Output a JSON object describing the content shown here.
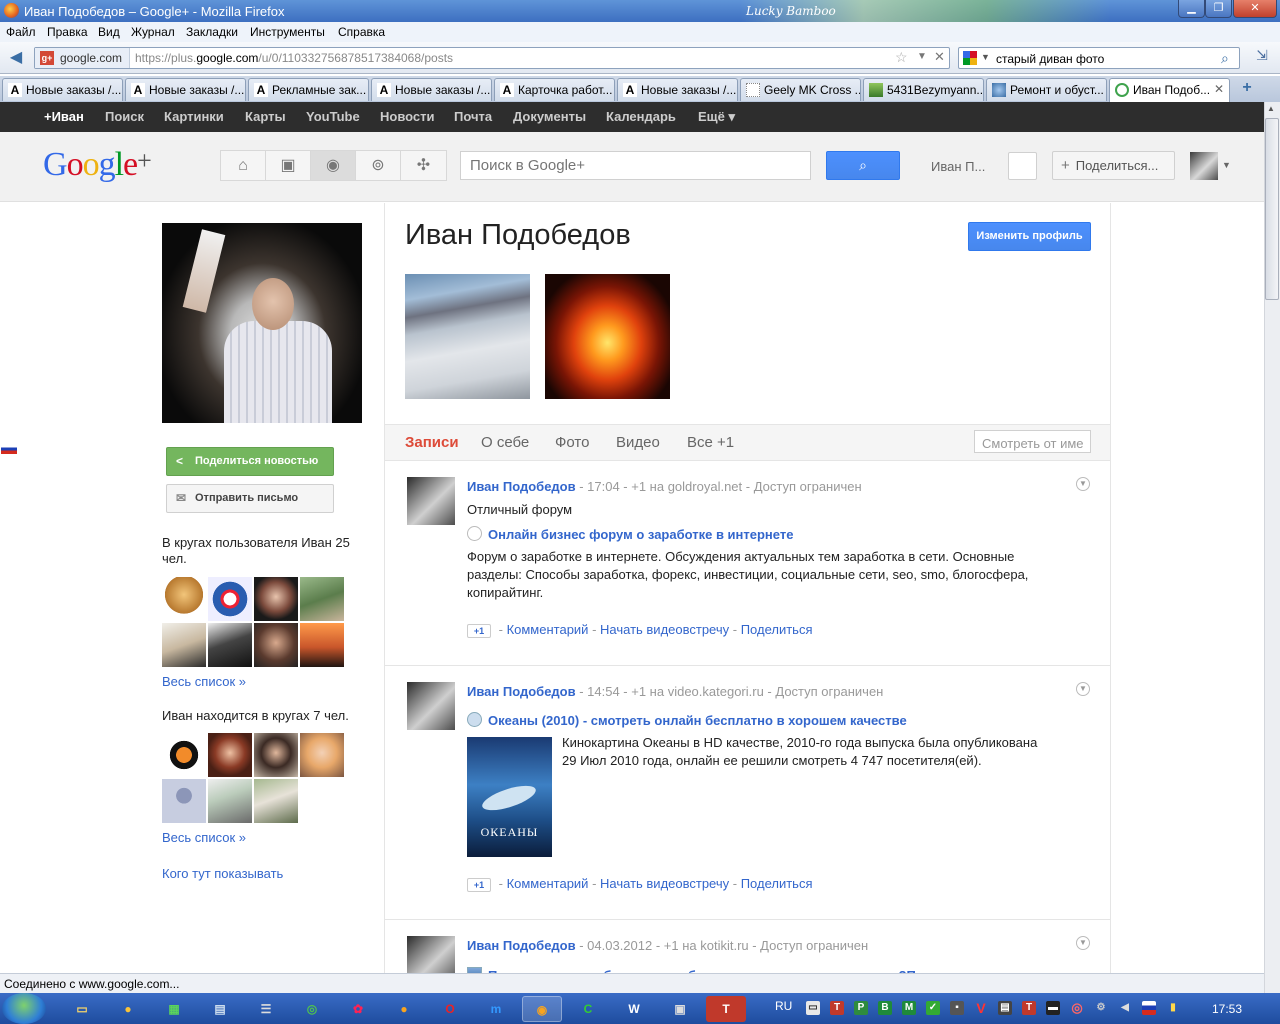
{
  "window": {
    "title": "Иван Подобедов – Google+ - Mozilla Firefox",
    "theme_text": "Lucky Bamboo"
  },
  "menu": [
    "Файл",
    "Правка",
    "Вид",
    "Журнал",
    "Закладки",
    "Инструменты",
    "Справка"
  ],
  "nav": {
    "site_badge": "google.com",
    "url_prefix": "https://plus.",
    "url_domain": "google.com",
    "url_path": "/u/0/110332756878517384068/posts",
    "search_value": "старый диван фото"
  },
  "tabs": [
    {
      "icon": "A",
      "label": "Новые заказы /..."
    },
    {
      "icon": "A",
      "label": "Новые заказы /..."
    },
    {
      "icon": "A",
      "label": "Рекламные зак..."
    },
    {
      "icon": "A",
      "label": "Новые заказы /..."
    },
    {
      "icon": "A",
      "label": "Карточка работ..."
    },
    {
      "icon": "A",
      "label": "Новые заказы /..."
    },
    {
      "icon": "",
      "label": "Geely MK Cross ..."
    },
    {
      "icon": "",
      "label": "5431Bezymyann..."
    },
    {
      "icon": "",
      "label": "Ремонт и обуст..."
    },
    {
      "icon": "",
      "label": "Иван Подоб..."
    }
  ],
  "gbar": [
    "+Иван",
    "Поиск",
    "Картинки",
    "Карты",
    "YouTube",
    "Новости",
    "Почта",
    "Документы",
    "Календарь",
    "Ещё ▾"
  ],
  "header": {
    "logo": {
      "g1": "G",
      "o1": "o",
      "o2": "o",
      "g2": "g",
      "l": "l",
      "e": "e",
      "plus": "+"
    },
    "search_placeholder": "Поиск в Google+",
    "user_short": "Иван П...",
    "share_label": "Поделиться..."
  },
  "left": {
    "post_button": "Поделиться новостью",
    "mail_button": "Отправить письмо",
    "circles_of_user": "В кругах пользователя Иван 25 чел.",
    "full_list_1": "Весь список »",
    "in_circles": "Иван находится в кругах 7 чел.",
    "full_list_2": "Весь список »",
    "who_to_show": "Кого тут показывать"
  },
  "profile": {
    "name": "Иван Подобедов",
    "edit_button": "Изменить профиль",
    "tabs": [
      "Записи",
      "О себе",
      "Фото",
      "Видео",
      "Все +1"
    ],
    "view_as_placeholder": "Смотреть от име"
  },
  "posts": [
    {
      "author": "Иван Подобедов",
      "meta": "  -  17:04  -  +1 на goldroyal.net  -  Доступ ограничен",
      "text": "Отличный форум",
      "link_title": "Онлайн бизнес форум о заработке в интернете",
      "desc": "Форум о заработке в интернете. Обсуждения актуальных тем заработка в сети. Основные разделы: Способы заработка, форекс, инвестиции, социальные сети, seo, smo, блогосфера, копирайтинг.",
      "actions": {
        "plus": "+1",
        "comment": "Комментарий",
        "hangout": "Начать видеовстречу",
        "share": "Поделиться"
      }
    },
    {
      "author": "Иван Подобедов",
      "meta": "  -  14:54  -  +1 на video.kategori.ru  -  Доступ ограничен",
      "link_title": "Океаны (2010) - смотреть онлайн бесплатно в хорошем качестве",
      "poster_text": "ОКЕАНЫ",
      "desc": "Кинокартина Океаны в HD качестве, 2010-го года выпуска была опубликована 29 Июл 2010 года, онлайн ее решили смотреть 4 747 посетителя(ей).",
      "actions": {
        "plus": "+1",
        "comment": "Комментарий",
        "hangout": "Начать видеовстречу",
        "share": "Поделиться"
      }
    },
    {
      "author": "Иван Подобедов",
      "meta": "  -  04.03.2012  -  +1 на kotikit.ru  -  Доступ ограничен",
      "link_title": "Правда ли, что ребенок может быть похож на первого мужчину?Правда ли, что"
    }
  ],
  "status": "Соединено с www.google.com...",
  "taskbar": {
    "lang": "RU",
    "clock": "17:53"
  },
  "colors": {
    "accent": "#3366cc",
    "gplus_red": "#dd4b39",
    "share_green": "#74b65e",
    "blue_button": "#4d90fe",
    "gbar": "#2d2d2d"
  }
}
